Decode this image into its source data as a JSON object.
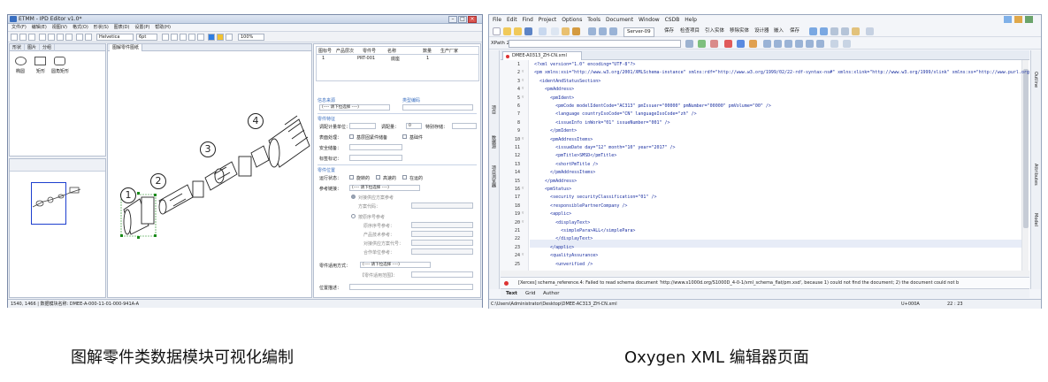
{
  "left_window": {
    "title": "ETMM - IPD Editor v1.0*",
    "window_buttons": [
      "–",
      "□",
      "×"
    ],
    "menu": [
      "文件(F)",
      "编辑(E)",
      "视图(V)",
      "格式(O)",
      "形状(S)",
      "图表(D)",
      "设置(P)",
      "帮助(H)"
    ],
    "toolbar": {
      "font": "Helvetica",
      "size": "6pt",
      "zoom": "100%"
    },
    "palette_tabs": [
      "形状",
      "图片",
      "分组"
    ],
    "palette_shapes": [
      "椭圆",
      "矩形",
      "圆角矩形"
    ],
    "canvas_tab": "图解零件图纸",
    "callouts": [
      "1",
      "2",
      "3",
      "4"
    ],
    "table": {
      "headers": [
        "图标号",
        "产品层次",
        "零件号",
        "名称",
        "数量",
        "生产厂家"
      ],
      "row": [
        "1",
        "",
        "PRT-001",
        "底座",
        "1",
        ""
      ]
    },
    "form": {
      "section_select": "信息来源",
      "section_catalog": "类型编码",
      "select_placeholder": "(---- 请下拉选择 ----)",
      "section_part": "零件特征",
      "min_order_qty": "调配计量单位：",
      "adjust_qty": "调配量：",
      "adjust_value": "0",
      "special_mark": "特别存储：",
      "surface_treatment": "表面处理：",
      "opt_base_support": "基层固紧件储备",
      "opt_base_frame": "基础件",
      "safety_qty": "安全储备：",
      "tag_label": "标签标记：",
      "section_position": "零件位置",
      "run_status": "运行状态：",
      "opt_rotating": "旋转的",
      "opt_dynamic": "高速的",
      "opt_running": "在运的",
      "reference_label": "参考链接：",
      "radio_fixed": "对接供应方案参考",
      "radio_scheme_code": "方案代码：",
      "radio_series": "按原序号参考",
      "original_seq": "原序序号参考：",
      "product_code": "产品技术参考：",
      "partner_code": "对接供应方案代号：",
      "combined_code": "合作单位参考：",
      "applicable_label": "零件适用方式：",
      "applicable_hint": "【零件适用范围】：",
      "location_label": "位置描述："
    },
    "status": "1540, 1466 | 数据模块名称: DMEE-A-000-11-01-000-941A-A"
  },
  "right_window": {
    "menu": [
      "File",
      "Edit",
      "Find",
      "Project",
      "Options",
      "Tools",
      "Document",
      "Window",
      "CSDB",
      "Help"
    ],
    "toolbar_text": [
      "Server-09",
      "保存",
      "检查项目",
      "引入实体",
      "移除实体",
      "设计器",
      "嵌入",
      "保存"
    ],
    "xpath_label": "XPath 2.0",
    "side_left": [
      "项目",
      "数据源",
      "项目浏览器"
    ],
    "side_right": [
      "Outline",
      "Attributes",
      "Model"
    ],
    "tab": "DMEE-A0313_ZH-CN.xml",
    "lines": [
      {
        "n": "1",
        "t": "<?xml version=\"1.0\" encoding=\"UTF-8\"?>"
      },
      {
        "n": "2",
        "t": "<pm xmlns:xsi=\"http://www.w3.org/2001/XMLSchema-instance\" xmlns:rdf=\"http://www.w3.org/1999/02/22-rdf-syntax-ns#\" xmlns:xlink=\"http://www.w3.org/1999/xlink\" xmlns:xs=\"http://www.purl.org\""
      },
      {
        "n": "3",
        "t": "  <identAndStatusSection>"
      },
      {
        "n": "4",
        "t": "    <pmAddress>"
      },
      {
        "n": "5",
        "t": "      <pmIdent>"
      },
      {
        "n": "6",
        "t": "        <pmCode modelIdentCode=\"AC313\" pmIssuer=\"00000\" pmNumber=\"00000\" pmVolume=\"00\" />"
      },
      {
        "n": "7",
        "t": "        <language countryIsoCode=\"CN\" languageIsoCode=\"zh\" />"
      },
      {
        "n": "8",
        "t": "        <issueInfo inWork=\"01\" issueNumber=\"001\" />"
      },
      {
        "n": "9",
        "t": "      </pmIdent>"
      },
      {
        "n": "10",
        "t": "      <pmAddressItems>"
      },
      {
        "n": "11",
        "t": "        <issueDate day=\"12\" month=\"10\" year=\"2017\" />"
      },
      {
        "n": "12",
        "t": "        <pmTitle>SMSD</pmTitle>"
      },
      {
        "n": "13",
        "t": "        <shortPmTitle />"
      },
      {
        "n": "14",
        "t": "      </pmAddressItems>"
      },
      {
        "n": "15",
        "t": "    </pmAddress>"
      },
      {
        "n": "16",
        "t": "    <pmStatus>"
      },
      {
        "n": "17",
        "t": "      <security securityClassification=\"01\" />"
      },
      {
        "n": "18",
        "t": "      <responsiblePartnerCompany />"
      },
      {
        "n": "19",
        "t": "      <applic>"
      },
      {
        "n": "20",
        "t": "        <displayText>"
      },
      {
        "n": "21",
        "t": "          <simplePara>ALL</simplePara>"
      },
      {
        "n": "22",
        "t": "        </displayText>"
      },
      {
        "n": "23",
        "t": "      </applic>"
      },
      {
        "n": "24",
        "t": "      <qualityAssurance>"
      },
      {
        "n": "25",
        "t": "        <unverified />"
      }
    ],
    "error": "[Xerces] schema_reference.4: Failed to read schema document 'http://www.s1000d.org/S1000D_4-0-1/xml_schema_flat/pm.xsd', because 1) could not find the document; 2) the document could not b",
    "modes": [
      "Text",
      "Grid",
      "Author"
    ],
    "status_path": "C:\\Users\\Administrator\\Desktop\\DMEE-AC313_ZH-CN.xml",
    "status_code": "U+000A",
    "status_pos": "22 : 23"
  },
  "captions": {
    "left": "图解零件类数据模块可视化编制",
    "right": "Oxygen XML 编辑器页面"
  }
}
